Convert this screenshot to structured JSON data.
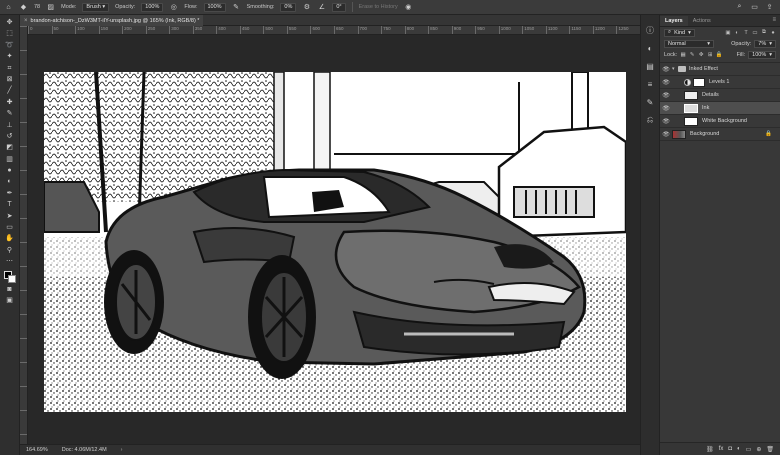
{
  "options_bar": {
    "mode_label": "Mode:",
    "mode_value": "Brush",
    "opacity_label": "Opacity:",
    "opacity_value": "100%",
    "flow_label": "Flow:",
    "flow_value": "100%",
    "smoothing_label": "Smoothing:",
    "smoothing_value": "0%",
    "angle_value": "0°",
    "erase_history_label": "Erase to History",
    "brush_size": "78"
  },
  "document": {
    "tab_title": "brandon-atchison-_DzW3MT-iIY-unsplash.jpg @ 165% (Ink, RGB/8) *"
  },
  "ruler": {
    "h_labels": [
      "0",
      "50",
      "100",
      "150",
      "200",
      "250",
      "300",
      "350",
      "400",
      "450",
      "500",
      "550",
      "600",
      "650",
      "700",
      "750",
      "800",
      "850",
      "900",
      "950",
      "1000",
      "1050",
      "1100",
      "1150",
      "1200",
      "1250"
    ]
  },
  "status": {
    "zoom": "164.69%",
    "doc": "Doc: 4.06M/12.4M"
  },
  "layers_panel": {
    "tabs": [
      "Layers",
      "Actions"
    ],
    "kind_label": "Kind",
    "blend_mode": "Normal",
    "opacity_label": "Opacity:",
    "opacity_value": "7%",
    "lock_label": "Lock:",
    "fill_label": "Fill:",
    "fill_value": "100%",
    "layers": [
      {
        "name": "Inked Effect",
        "type": "group"
      },
      {
        "name": "Levels 1",
        "type": "adjustment"
      },
      {
        "name": "Details",
        "type": "pixel"
      },
      {
        "name": "Ink",
        "type": "pixel",
        "selected": true
      },
      {
        "name": "White Background",
        "type": "pixel"
      },
      {
        "name": "Background",
        "type": "background"
      }
    ],
    "bottom_icons": [
      "link-icon",
      "fx-icon",
      "mask-icon",
      "adjustment-icon",
      "folder-icon",
      "new-layer-icon",
      "trash-icon"
    ]
  },
  "colors": {
    "app_bg": "#282828",
    "panel_bg": "#383838",
    "selected_layer": "#4e4e4e"
  }
}
